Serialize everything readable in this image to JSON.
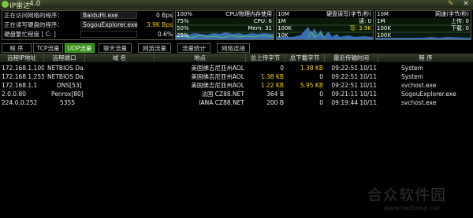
{
  "window": {
    "title": "IP雷达",
    "version": "4.0"
  },
  "status": {
    "rows": [
      {
        "label": "正在访问网络的程序：",
        "program": "BaiduHi.exe",
        "rate": "0 Bps",
        "rate_color": "#e6e6e6"
      },
      {
        "label": "正在读写硬盘的程序：",
        "program": "SogouExplorer.exe",
        "rate": "3.9K Bps",
        "rate_color": "#ffd200"
      },
      {
        "label": "硬盘繁忙程度 [ C: ]",
        "program": "",
        "rate": "0.6%",
        "rate_color": "#e6e6e6"
      }
    ]
  },
  "cpu_graph": {
    "header_left": "100%",
    "header_right": "CPU/物理内存使用",
    "l1": "75%",
    "r1": "CPU: 6",
    "l2": "50%",
    "r2": "Mem: 31",
    "l3": "25%",
    "r3": ""
  },
  "disk_graph": {
    "header_left": "10M",
    "header_right": "硬盘读写(字节/秒)",
    "l1": "1M",
    "r1": "读: 0",
    "l2": "100K",
    "r2": "写: 3.9K",
    "l3": "10K",
    "r3": ""
  },
  "net_graph": {
    "header_left": "10M",
    "header_right": "网速(字节/秒)",
    "l1": "1M",
    "r1": "上传: 0",
    "l2": "100K",
    "r2": "下载: 0",
    "l3": "100K",
    "r3": ""
  },
  "tabs": [
    {
      "label": "程 序",
      "active": false
    },
    {
      "label": "TCP流量",
      "active": false
    },
    {
      "label": "UDP流量",
      "active": true
    },
    {
      "label": "聊天流量",
      "active": false
    },
    {
      "label": "网游流量",
      "active": false
    },
    {
      "label": "流量统计",
      "active": false
    },
    {
      "label": "网络连接",
      "active": false
    }
  ],
  "table": {
    "headers": [
      "远程IP地址",
      "远程端口",
      "域 名",
      "地点",
      "总上传字节",
      "总下载字节",
      "最近传输时间",
      "程 序"
    ],
    "rows": [
      {
        "ip": "172.168.1.100",
        "port": "NETBIOS Da...",
        "domain": "",
        "location": "美国佛吉尼亚州AOL",
        "up": "0",
        "down": "1.38 KB",
        "time": "09:22:51 10/11",
        "program": "System"
      },
      {
        "ip": "172.168.1.255",
        "port": "NETBIOS Da...",
        "domain": "",
        "location": "美国佛吉尼亚州AOL",
        "up": "1.38 KB",
        "down": "0",
        "time": "09:22:51 10/11",
        "program": "System"
      },
      {
        "ip": "172.168.1.1",
        "port": "DNS[53]",
        "domain": "",
        "location": "美国佛吉尼亚州AOL",
        "up": "1.22 KB",
        "down": "5.95 KB",
        "time": "09:22:51 10/11",
        "program": "svchost.exe"
      },
      {
        "ip": "2.0.0.80",
        "port": "Penrox[80]",
        "domain": "",
        "location": "法国 CZ88.NET",
        "up": "364 B",
        "down": "0",
        "time": "09:21:11 10/11",
        "program": "SogouExplorer.exe"
      },
      {
        "ip": "224.0.0.252",
        "port": "5355",
        "domain": "",
        "location": "IANA CZ88.NET",
        "up": "200 B",
        "down": "0",
        "time": "09:19:44 10/11",
        "program": "svchost.exe"
      }
    ]
  },
  "watermark": {
    "text": "合众软件园",
    "url": "www.hezhong.net"
  }
}
